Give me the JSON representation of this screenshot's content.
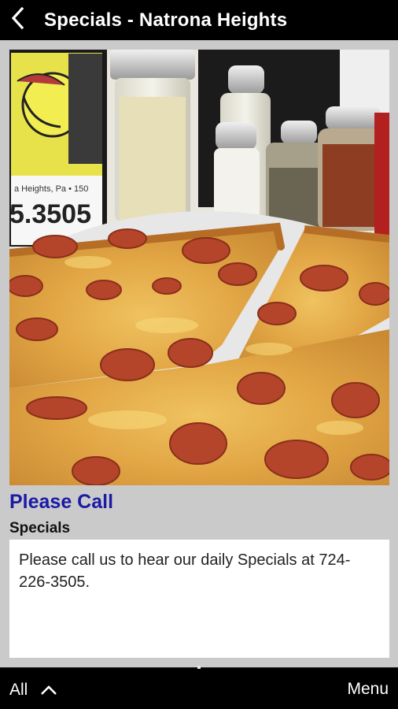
{
  "header": {
    "title": "Specials - Natrona Heights"
  },
  "special": {
    "title": "Please Call",
    "category": "Specials",
    "description": "Please call us to hear our daily Specials at 724-226-3505."
  },
  "photo_sign": {
    "line1": "a Heights, Pa • 150",
    "line2": "5.3505"
  },
  "bottom_bar": {
    "all_label": "All",
    "menu_label": "Menu"
  },
  "colors": {
    "title_blue": "#1a1aa6",
    "bar_black": "#000000",
    "content_gray": "#cacaca"
  },
  "icons": {
    "back": "chevron-left-icon",
    "expand": "chevron-up-icon"
  }
}
